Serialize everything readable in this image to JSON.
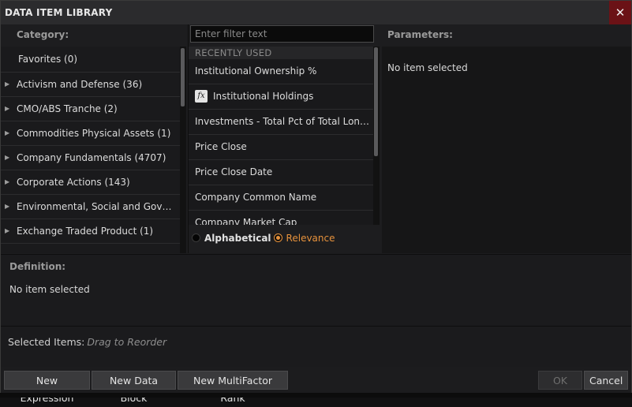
{
  "window": {
    "title": "DATA ITEM LIBRARY",
    "close_symbol": "✕"
  },
  "category": {
    "header": "Category:",
    "items": [
      {
        "label": "Favorites (0)",
        "expandable": false
      },
      {
        "label": "Activism and Defense (36)",
        "expandable": true
      },
      {
        "label": "CMO/ABS Tranche (2)",
        "expandable": true
      },
      {
        "label": "Commodities Physical Assets (1)",
        "expandable": true
      },
      {
        "label": "Company Fundamentals (4707)",
        "expandable": true
      },
      {
        "label": "Corporate Actions (143)",
        "expandable": true
      },
      {
        "label": "Environmental, Social and Governance",
        "expandable": true
      },
      {
        "label": "Exchange Traded Product (1)",
        "expandable": true
      }
    ]
  },
  "items": {
    "filter_placeholder": "Enter filter text",
    "section_header": "RECENTLY USED",
    "rows": [
      {
        "label": "Institutional Ownership %",
        "icon": null
      },
      {
        "label": "Institutional Holdings",
        "icon": "function-fx-icon"
      },
      {
        "label": "Investments - Total Pct of Total Long Term Assets",
        "icon": null
      },
      {
        "label": "Price Close",
        "icon": null
      },
      {
        "label": "Price Close Date",
        "icon": null
      },
      {
        "label": "Company Common Name",
        "icon": null
      },
      {
        "label": "Company Market Cap",
        "icon": null
      }
    ],
    "sort": {
      "options": [
        "Alphabetical",
        "Relevance"
      ],
      "selected": "Relevance"
    }
  },
  "parameters": {
    "header": "Parameters:",
    "message": "No item selected"
  },
  "definition": {
    "header": "Definition:",
    "message": "No item selected"
  },
  "selected_items": {
    "label": "Selected Items:",
    "hint": "Drag to Reorder"
  },
  "footer": {
    "new_expression": "New Expression",
    "new_data_block": "New Data Block",
    "new_multifactor_rank": "New MultiFactor Rank",
    "ok": "OK",
    "cancel": "Cancel"
  },
  "colors": {
    "accent": "#e7923c",
    "close_bg": "#6b1216",
    "background": "#1c1c1e"
  }
}
